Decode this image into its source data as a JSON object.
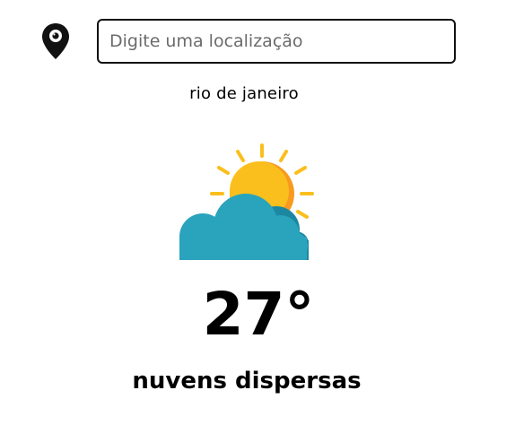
{
  "search": {
    "placeholder": "Digite uma localização",
    "value": ""
  },
  "location": {
    "city": "rio de janeiro"
  },
  "weather": {
    "icon": "sun-behind-cloud-icon",
    "temperature": "27°",
    "description": "nuvens dispersas"
  },
  "colors": {
    "sun": "#fbbf1d",
    "sun_shade": "#f79a1f",
    "cloud": "#2aa3bd",
    "cloud_shade": "#1d87a1"
  }
}
